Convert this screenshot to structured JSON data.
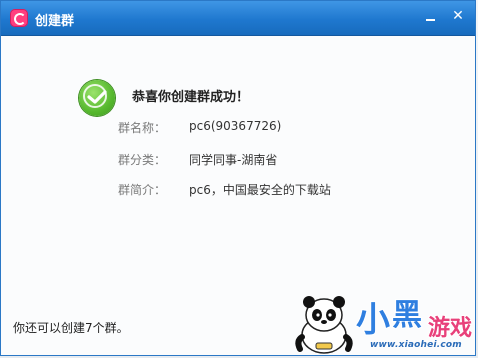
{
  "window": {
    "title": "创建群",
    "minimize_icon": "minimize-icon",
    "close_icon": "close-icon",
    "close_glyph": "✕"
  },
  "result": {
    "message": "恭喜你创建群成功！",
    "status_icon": "success-check-icon",
    "accent_color": "#56b82e"
  },
  "group_info": [
    {
      "label": "群名称：",
      "value": "pc6(90367726)"
    },
    {
      "label": "群分类：",
      "value": "同学同事-湖南省"
    },
    {
      "label": "群简介：",
      "value": "pc6，中国最安全的下载站"
    }
  ],
  "footer": {
    "note": "你还可以创建7个群。"
  },
  "watermark": {
    "brand_text": "小黑游戏",
    "url": "www.xiaohei.com"
  }
}
